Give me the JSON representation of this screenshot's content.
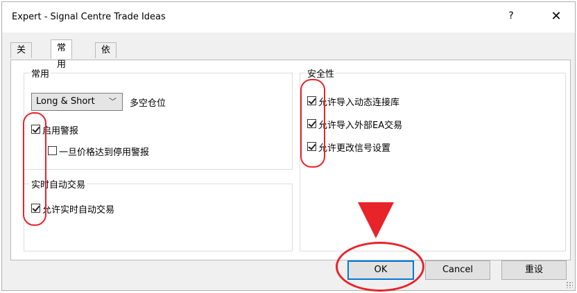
{
  "window": {
    "title": "Expert - Signal Centre Trade Ideas",
    "help": "?",
    "close": "✕"
  },
  "tabs": [
    {
      "label": "关于",
      "active": false
    },
    {
      "label": "常用",
      "active": true
    },
    {
      "label": "依存关系",
      "active": false
    }
  ],
  "common": {
    "group_title": "常用",
    "position_select": "Long & Short",
    "position_label": "多空仓位",
    "enable_alerts": {
      "label": "启用警报",
      "checked": true
    },
    "disable_alerts_on_stop": {
      "label": "一旦价格达到停用警报",
      "checked": false
    }
  },
  "live_trading": {
    "group_title": "实时自动交易",
    "allow_live": {
      "label": "允许实时自动交易",
      "checked": true
    }
  },
  "safety": {
    "group_title": "安全性",
    "allow_dll": {
      "label": "允许导入动态连接库",
      "checked": true
    },
    "allow_external_ea": {
      "label": "允许导入外部EA交易",
      "checked": true
    },
    "allow_modify_signal": {
      "label": "允许更改信号设置",
      "checked": true
    }
  },
  "buttons": {
    "ok": "OK",
    "cancel": "Cancel",
    "reset": "重设"
  },
  "colors": {
    "annotation": "#e8232a",
    "default_button_border": "#0078d7"
  }
}
